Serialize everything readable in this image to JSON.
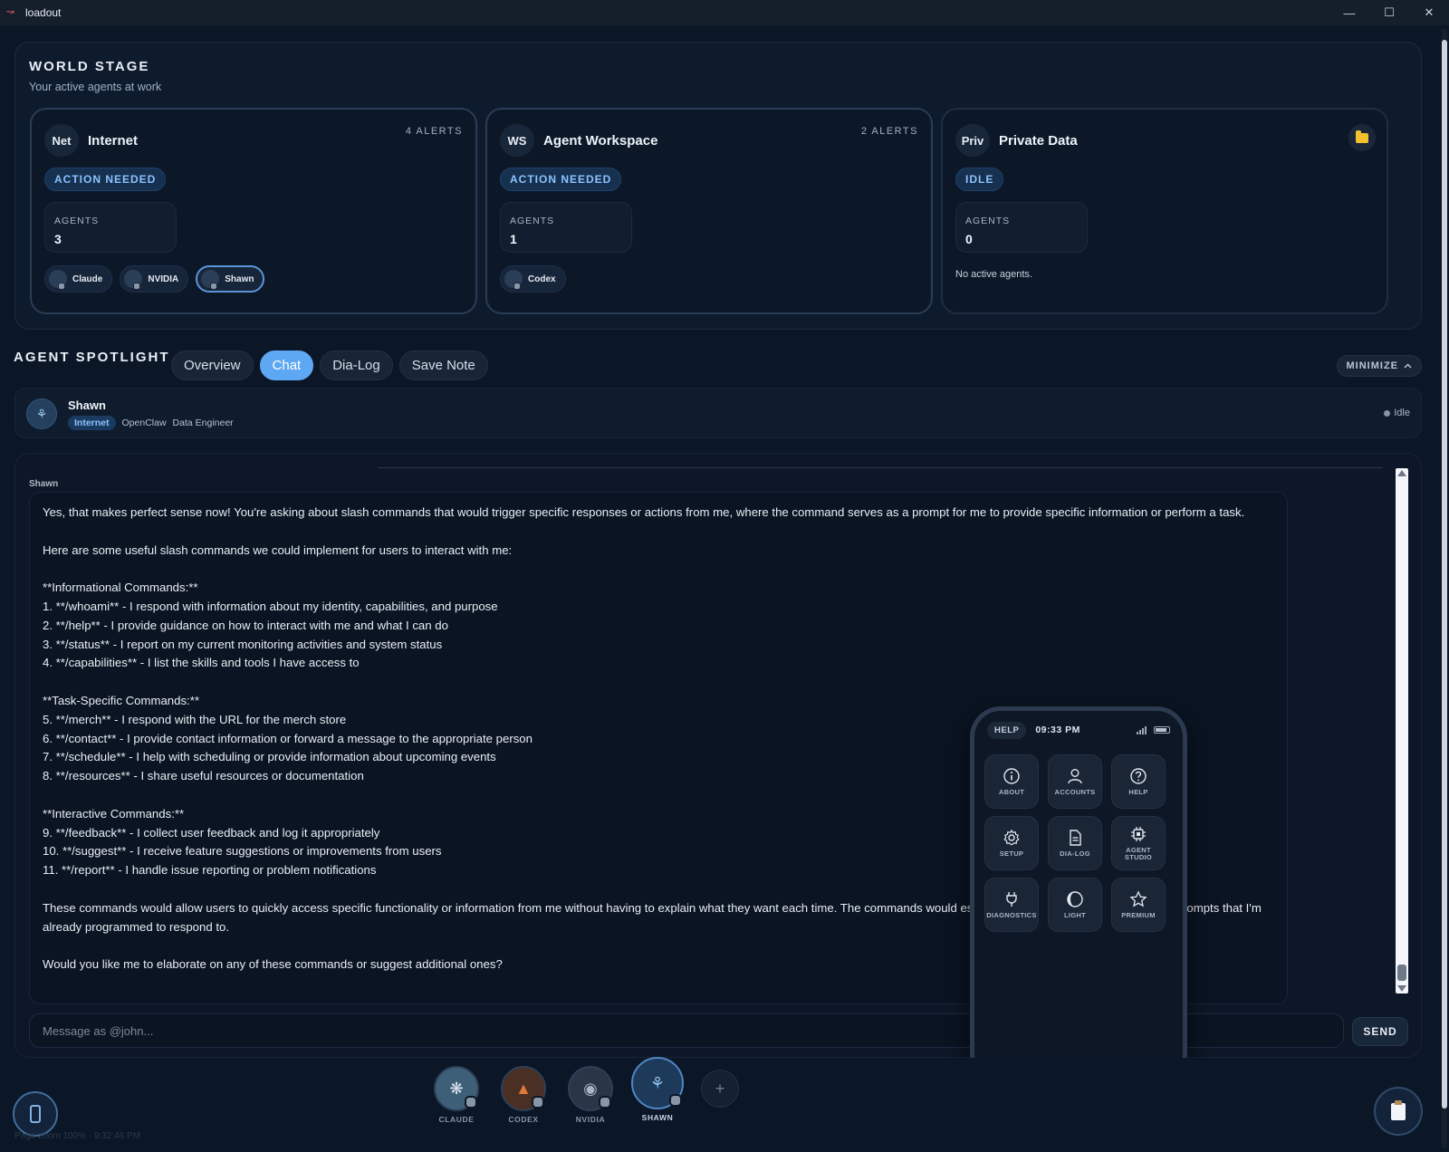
{
  "window": {
    "title": "loadout",
    "minimize": "—",
    "maximize": "☐",
    "close": "✕"
  },
  "world_stage": {
    "title": "WORLD STAGE",
    "subtitle": "Your active agents at work",
    "agents_label": "AGENTS",
    "zones": [
      {
        "badge": "Net",
        "name": "Internet",
        "alerts": "4 ALERTS",
        "status": "ACTION NEEDED",
        "agent_count": "3",
        "agents": [
          "Claude",
          "NVIDIA",
          "Shawn"
        ],
        "selected_agent": "Shawn"
      },
      {
        "badge": "WS",
        "name": "Agent Workspace",
        "alerts": "2 ALERTS",
        "status": "ACTION NEEDED",
        "agent_count": "1",
        "agents": [
          "Codex"
        ]
      },
      {
        "badge": "Priv",
        "name": "Private Data",
        "icon": "folder-icon",
        "status": "IDLE",
        "agent_count": "0",
        "empty_text": "No active agents."
      }
    ]
  },
  "spotlight": {
    "title": "AGENT SPOTLIGHT",
    "tabs": [
      "Overview",
      "Chat",
      "Dia-Log",
      "Save Note"
    ],
    "active_tab": "Chat",
    "minimize_label": "MINIMIZE",
    "agent": {
      "name": "Shawn",
      "zone": "Internet",
      "platform": "OpenClaw",
      "role": "Data Engineer",
      "status": "Idle"
    }
  },
  "chat": {
    "author": "Shawn",
    "message": "Yes, that makes perfect sense now! You're asking about slash commands that would trigger specific responses or actions from me, where the command serves as a prompt for me to provide specific information or perform a task.\n\nHere are some useful slash commands we could implement for users to interact with me:\n\n**Informational Commands:**\n1. **/whoami** - I respond with information about my identity, capabilities, and purpose\n2. **/help** - I provide guidance on how to interact with me and what I can do\n3. **/status** - I report on my current monitoring activities and system status\n4. **/capabilities** - I list the skills and tools I have access to\n\n**Task-Specific Commands:**\n5. **/merch** - I respond with the URL for the merch store\n6. **/contact** - I provide contact information or forward a message to the appropriate person\n7. **/schedule** - I help with scheduling or provide information about upcoming events\n8. **/resources** - I share useful resources or documentation\n\n**Interactive Commands:**\n9. **/feedback** - I collect user feedback and log it appropriately\n10. **/suggest** - I receive feature suggestions or improvements from users\n11. **/report** - I handle issue reporting or problem notifications\n\nThese commands would allow users to quickly access specific functionality or information from me without having to explain what they want each time. The commands would essentially serve as shortcuts to specific prompts that I'm already programmed to respond to.\n\nWould you like me to elaborate on any of these commands or suggest additional ones?",
    "input_placeholder": "Message as @john...",
    "send_label": "SEND"
  },
  "phone": {
    "help_label": "HELP",
    "time": "09:33 PM",
    "tiles": [
      {
        "label": "ABOUT",
        "icon": "info-icon"
      },
      {
        "label": "ACCOUNTS",
        "icon": "user-icon"
      },
      {
        "label": "HELP",
        "icon": "question-icon"
      },
      {
        "label": "SETUP",
        "icon": "gear-icon"
      },
      {
        "label": "DIA-LOG",
        "icon": "document-icon"
      },
      {
        "label": "AGENT\nSTUDIO",
        "icon": "chip-icon"
      },
      {
        "label": "DIAGNOSTICS",
        "icon": "plug-icon"
      },
      {
        "label": "LIGHT",
        "icon": "theme-icon"
      },
      {
        "label": "PREMIUM",
        "icon": "star-icon"
      }
    ]
  },
  "dock": {
    "agents": [
      "CLAUDE",
      "CODEX",
      "NVIDIA",
      "SHAWN"
    ],
    "active": "SHAWN",
    "add_label": "+"
  },
  "footer": {
    "zoom_info": "Page zoom 100% · 9:32:46 PM"
  },
  "colors": {
    "accent": "#5ea7f2",
    "status_blue": "#8cc2ff",
    "folder": "#f3c02f",
    "background": "#0b1626"
  }
}
